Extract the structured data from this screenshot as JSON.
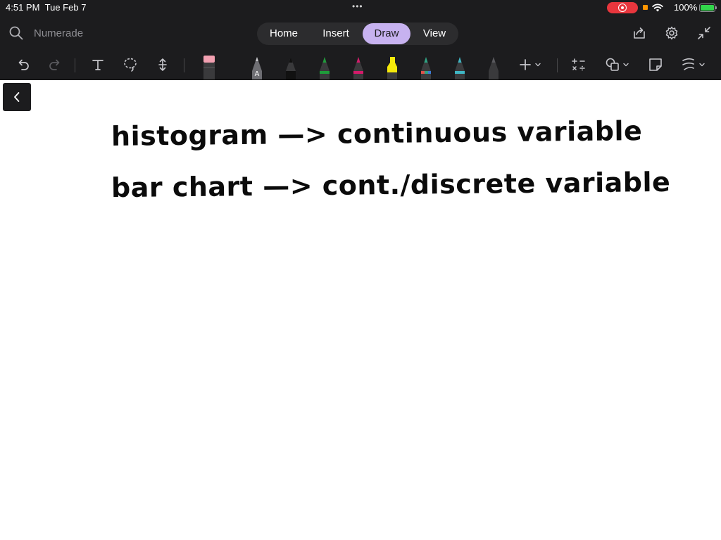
{
  "status_bar": {
    "time": "4:51 PM",
    "date": "Tue Feb 7",
    "battery": "100%",
    "multitask_dots": "•••"
  },
  "top_bar": {
    "search_placeholder": "Numerade",
    "tabs": [
      {
        "label": "Home",
        "active": false
      },
      {
        "label": "Insert",
        "active": false
      },
      {
        "label": "Draw",
        "active": true
      },
      {
        "label": "View",
        "active": false
      }
    ],
    "right_icons": [
      "share-icon",
      "settings-icon",
      "collapse-icon"
    ]
  },
  "toolbar": {
    "pen_colors": {
      "pencil": "#6e6e73",
      "black": "#111111",
      "green": "#1f9b3a",
      "magenta": "#d31b6a",
      "highlighter": "#f5e90a",
      "teal_multi": "#2ea383",
      "cyan": "#3fb6c4",
      "gray": "#5a5a5e"
    },
    "pencil_letter": "A",
    "icons": [
      "undo-icon",
      "redo-icon",
      "text-icon",
      "lasso-icon",
      "space-icon",
      "eraser-icon",
      "add-icon",
      "math-icon",
      "shapes-icon",
      "sticky-note-icon",
      "ink-to-shape-icon"
    ]
  },
  "canvas": {
    "lines": [
      "histogram —> continuous variable",
      "bar chart —> cont./discrete variable"
    ]
  },
  "colors": {
    "chrome": "#1c1c1e",
    "active_tab": "#c7b2f0",
    "record": "#e8363d",
    "battery_green": "#32d74b"
  }
}
